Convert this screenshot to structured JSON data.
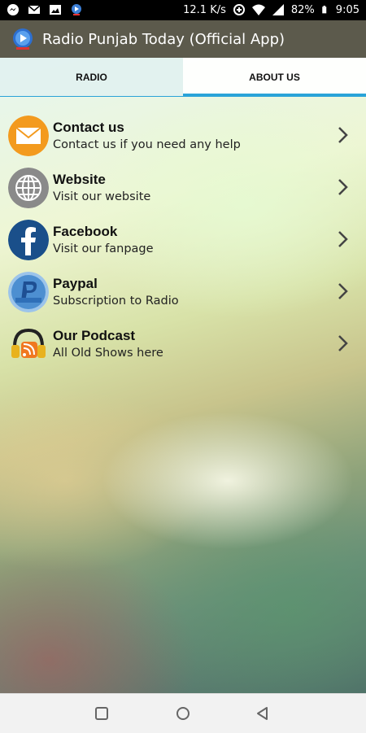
{
  "status_bar": {
    "speed": "12.1 K/s",
    "battery": "82%",
    "time": "9:05",
    "icons": [
      "messenger-icon",
      "gmail-icon",
      "image-icon",
      "app-notification-icon",
      "data-saver-icon",
      "wifi-icon",
      "signal-icon",
      "battery-icon"
    ]
  },
  "app_bar": {
    "title": "Radio Punjab Today (Official App)",
    "logo_icon": "radio-play-logo-icon"
  },
  "tabs": [
    {
      "label": "RADIO",
      "selected": false
    },
    {
      "label": "ABOUT US",
      "selected": true
    }
  ],
  "items": [
    {
      "title": "Contact us",
      "subtitle": "Contact us if you need any help",
      "icon": "mail-icon"
    },
    {
      "title": "Website",
      "subtitle": "Visit our website",
      "icon": "globe-icon"
    },
    {
      "title": "Facebook",
      "subtitle": "Visit our fanpage",
      "icon": "facebook-icon"
    },
    {
      "title": "Paypal",
      "subtitle": "Subscription to Radio",
      "icon": "paypal-icon"
    },
    {
      "title": "Our Podcast",
      "subtitle": "All Old Shows here",
      "icon": "podcast-icon"
    }
  ],
  "nav_bar": {
    "buttons": [
      "recents-button",
      "home-button",
      "back-button"
    ]
  },
  "colors": {
    "app_bar": "#5c5a4c",
    "tab_indicator": "#2aa3d8",
    "mail_orange": "#f39a1e",
    "globe_gray": "#8a8a8a",
    "facebook_blue": "#1a4f8a",
    "paypal_blue": "#4d8fd1"
  }
}
